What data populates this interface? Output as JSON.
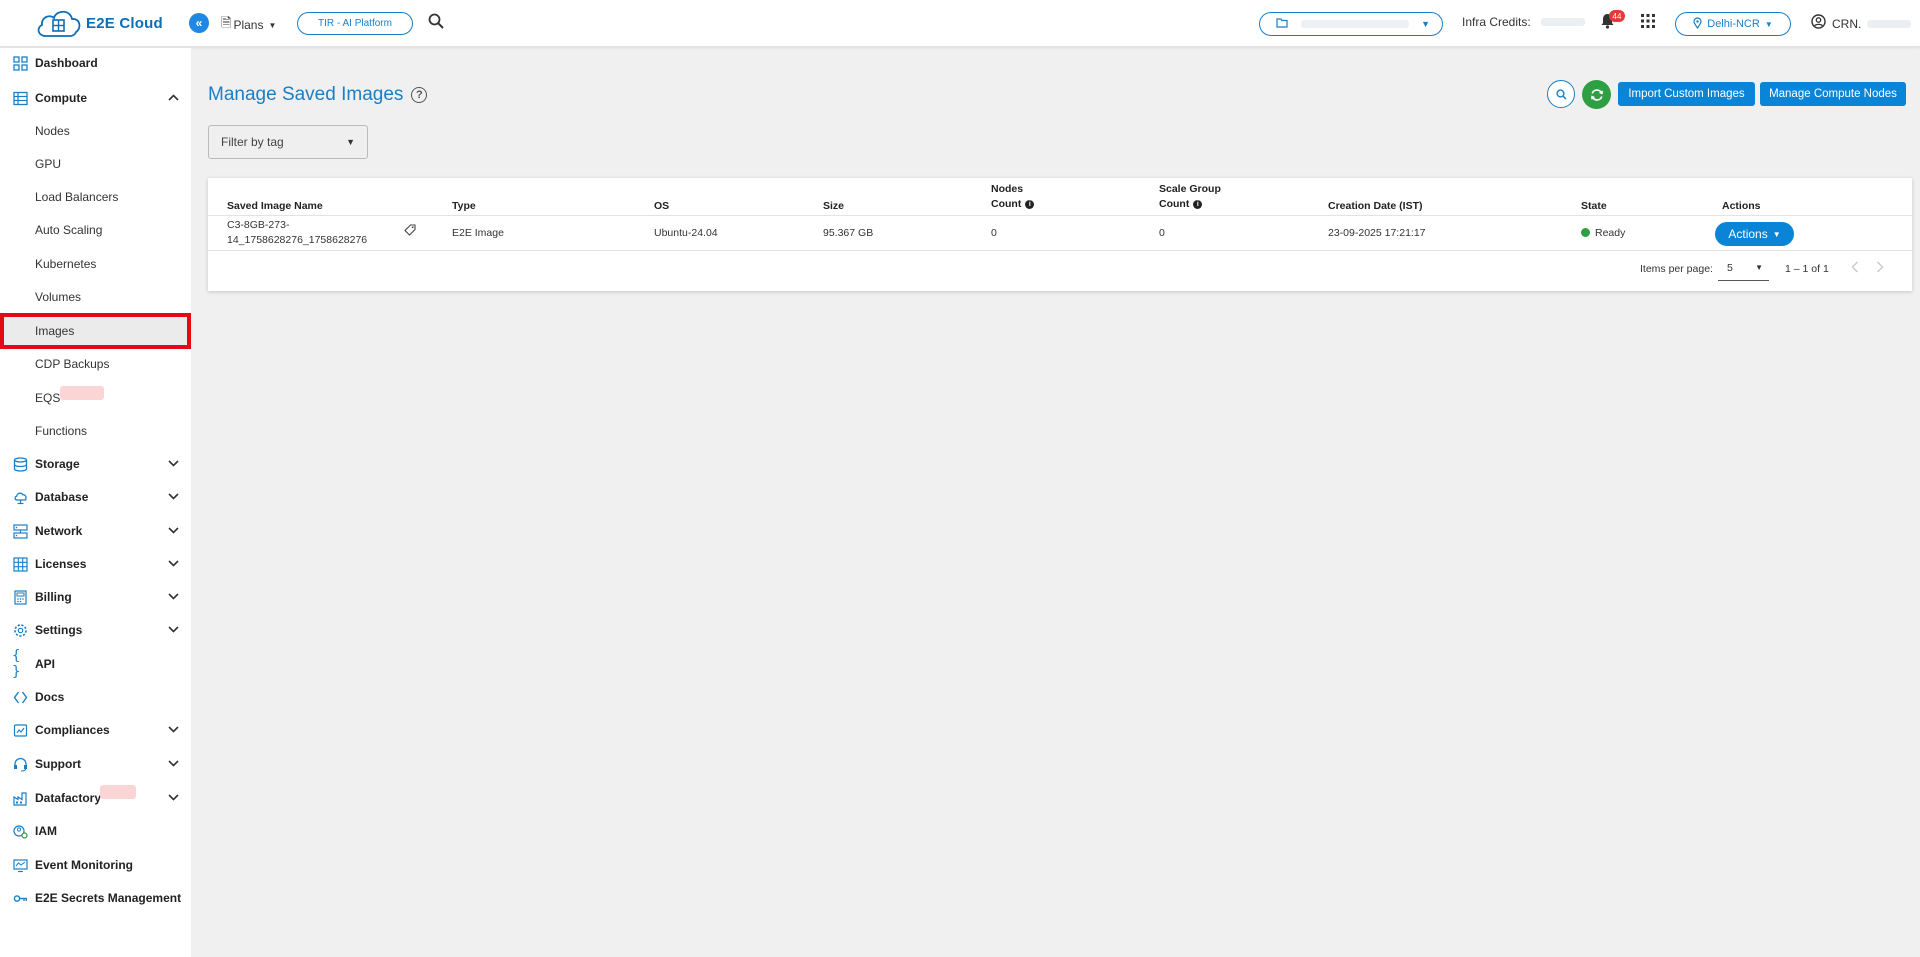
{
  "topbar": {
    "logo_text": "E2E Cloud",
    "collapse_glyph": "«",
    "plans_label": "Plans",
    "tir_label": "TIR - AI Platform",
    "infra_label": "Infra Credits:",
    "notification_count": "44",
    "region_label": "Delhi-NCR",
    "user_label": "CRN."
  },
  "sidebar": {
    "dashboard": "Dashboard",
    "compute": "Compute",
    "compute_items": [
      "Nodes",
      "GPU",
      "Load Balancers",
      "Auto Scaling",
      "Kubernetes",
      "Volumes",
      "Images",
      "CDP Backups",
      "EQS",
      "Functions"
    ],
    "active_item": "Images",
    "storage": "Storage",
    "database": "Database",
    "network": "Network",
    "licenses": "Licenses",
    "billing": "Billing",
    "settings": "Settings",
    "api": "API",
    "docs": "Docs",
    "compliances": "Compliances",
    "support": "Support",
    "datafactory": "Datafactory",
    "iam": "IAM",
    "event_monitoring": "Event Monitoring",
    "secrets": "E2E Secrets Management"
  },
  "main": {
    "title": "Manage Saved Images",
    "import_button": "Import Custom Images",
    "manage_button": "Manage Compute Nodes",
    "filter_placeholder": "Filter by tag",
    "columns": {
      "name": "Saved Image Name",
      "type": "Type",
      "os": "OS",
      "size": "Size",
      "nodes_count_1": "Nodes",
      "nodes_count_2": "Count",
      "scale_group_1": "Scale Group",
      "scale_group_2": "Count",
      "creation_date": "Creation Date (IST)",
      "state": "State",
      "actions": "Actions"
    },
    "rows": [
      {
        "name_line1": "C3-8GB-273-",
        "name_line2": "14_1758628276_1758628276",
        "type": "E2E Image",
        "os": "Ubuntu-24.04",
        "size": "95.367 GB",
        "nodes_count": "0",
        "scale_group_count": "0",
        "creation_date": "23-09-2025 17:21:17",
        "state": "Ready",
        "actions_label": "Actions"
      }
    ],
    "pagination": {
      "items_per_page_label": "Items per page:",
      "items_per_page": "5",
      "range": "1 – 1 of 1"
    }
  },
  "colors": {
    "brand_blue": "#0a84d6",
    "ready_green": "#2ea043",
    "highlight_red": "#e50914"
  }
}
